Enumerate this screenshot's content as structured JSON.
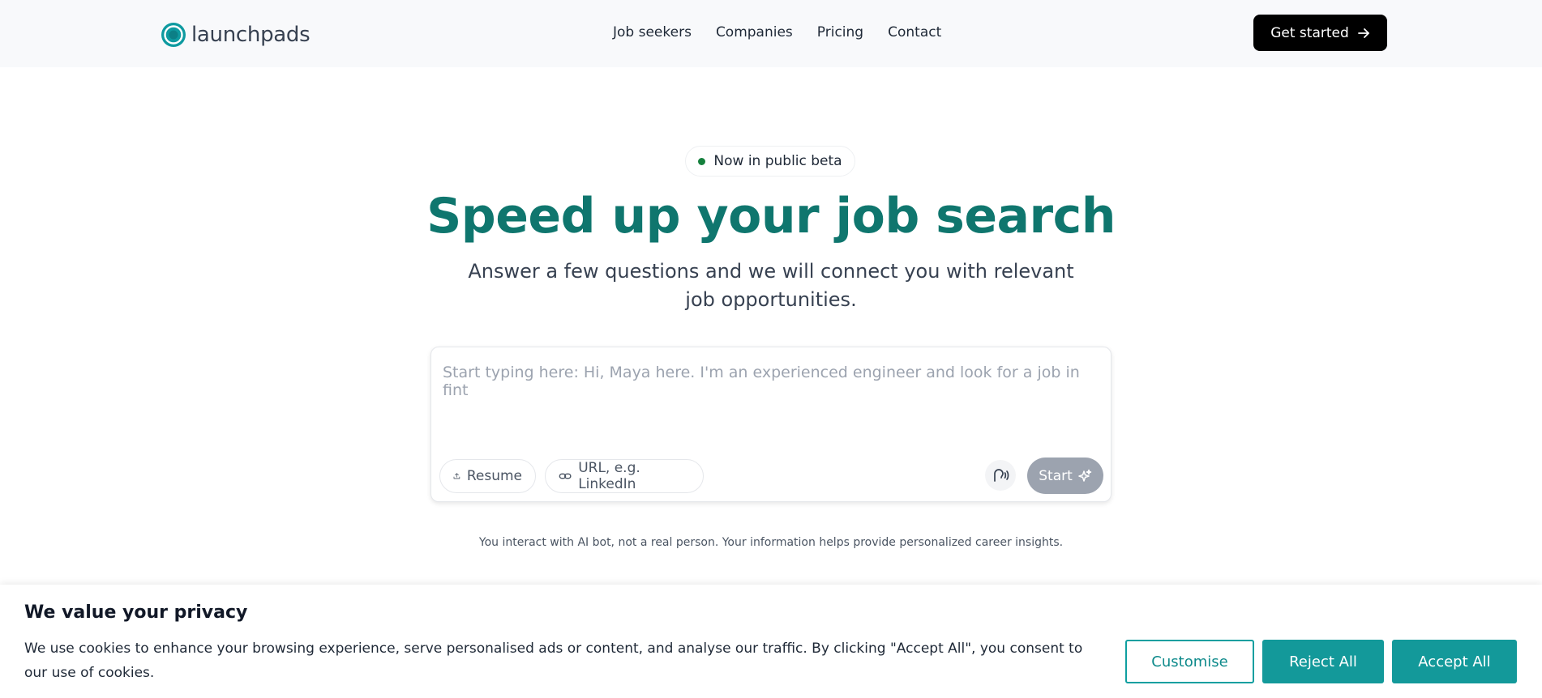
{
  "header": {
    "logo_text": "launchpads",
    "nav": [
      "Job seekers",
      "Companies",
      "Pricing",
      "Contact"
    ],
    "cta_label": "Get started"
  },
  "hero": {
    "badge": "Now in public beta",
    "title": "Speed up your job search",
    "subtitle": "Answer a few questions and we will connect you with relevant job opportunities."
  },
  "input": {
    "placeholder": "Start typing here: Hi, Maya here. I'm an experienced engineer and look for a job in fint",
    "value": "",
    "resume_label": "Resume",
    "url_label": "URL, e.g. LinkedIn",
    "start_label": "Start"
  },
  "disclaimer": "You interact with AI bot, not a real person. Your information helps provide personalized career insights.",
  "cookie": {
    "title": "We value your privacy",
    "text": "We use cookies to enhance your browsing experience, serve personalised ads or content, and analyse our traffic. By clicking \"Accept All\", you consent to our use of cookies.",
    "customise_label": "Customise",
    "reject_label": "Reject All",
    "accept_label": "Accept All"
  },
  "colors": {
    "brand": "#0f766e",
    "accent": "#13999a",
    "badge_dot": "#15803d",
    "start_disabled": "#9ca3af"
  },
  "icons": {
    "logo": "launchpads-logo-icon",
    "cta": "arrow-right-icon",
    "resume": "upload-icon",
    "url": "link-icon",
    "voice": "voice-icon",
    "start": "sparkle-icon"
  }
}
